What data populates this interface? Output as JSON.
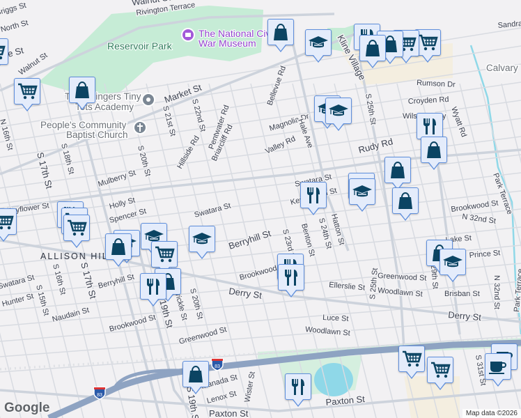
{
  "map": {
    "attribution": "Map data ©2026",
    "logo": "Google",
    "neighborhood": "ALLISON HILL",
    "park": "Reservoir Park",
    "places": {
      "museum": [
        "The National Civil",
        "War Museum"
      ],
      "academy": [
        "The Stringers Tiny",
        "Tots Academy"
      ],
      "church": [
        "People's Community",
        "Baptist Church"
      ],
      "cemetery": "Calvary"
    },
    "highway_shield": "83",
    "streets": {
      "walnut_top": "Walnut St",
      "rivington": "Rivington Terrace",
      "briggs": "Briggs St",
      "north": "North St",
      "state": "State St",
      "walnut": "Walnut St",
      "market": "Market St",
      "s21": "S 21st St",
      "s22": "S 22nd St",
      "hillside": "Hillside Rd",
      "pentwater": "Pentwater Rd",
      "briarcliff": "Briarcliff Rd",
      "s17": "S 17th St",
      "s18": "S 18th St",
      "n16": "N 16th St",
      "s20": "S 20th St",
      "mulberry": "Mulberry St",
      "holly": "Holly St",
      "spencer": "Spencer St",
      "swatara": "Swatara St",
      "mayflower": "Mayflower St",
      "bellevue": "Bellevue Rd",
      "magnolia": "Magnolia Dr",
      "valley": "Valley Rd",
      "kline": "Kline Village",
      "s25": "S 25th St",
      "rumson": "Rumson Dr",
      "croyden": "Croyden Rd",
      "wilson": "Wilson Pkwy",
      "wyatt": "Wyatt Rd",
      "rudy": "Rudy Rd",
      "swatara2": "Swatara St",
      "kensington": "Kensington St",
      "sandra": "Sandra",
      "park_terrace": "Park Terrace",
      "brookwood_e": "Brookwood St",
      "n32": "N 32nd St",
      "hale": "Hale Ave",
      "berryhill": "Berryhill St",
      "s23": "S 23rd St",
      "benton": "Benton St",
      "s24": "S 24th St",
      "hatton": "Hatton St",
      "swatara3": "Swatara St",
      "s16": "S 16th St",
      "s17b": "S 17th St",
      "hunter": "Hunter St",
      "s15": "S 15th St",
      "berryhill2": "Berryhill St",
      "naudain": "Naudain St",
      "brookwood": "Brookwood St",
      "s20b": "S 20th St",
      "greenwood": "Greenwood St",
      "derry": "Derry St",
      "brookwood2": "Brookwood St",
      "s19": "S 19th St",
      "crickle": "Crickle St",
      "greenwood2": "Greenwood St",
      "ellerslie": "Ellerslie St",
      "woodlawn": "Woodlawn St",
      "s25b": "S 25th St",
      "brisban": "Brisban St",
      "n32b": "N 32nd St",
      "park_terrace2": "Park Terrace",
      "derry2": "Derry St",
      "luce": "Luce St",
      "woodlawn2": "Woodlawn St",
      "s31": "S 31st St",
      "prince": "Prince St",
      "lake": "Lake St",
      "s29": "S 29th St",
      "paxton": "Paxton St",
      "paxton2": "Paxton St",
      "s19b": "S 19th St",
      "wister": "Wister St",
      "manada": "Manada St",
      "lenox": "Lenox St"
    },
    "colors": {
      "park": "#c6ecd6",
      "water": "#8fd8e8",
      "highway": "#8ea3c2",
      "marker_icon": "#0b4463",
      "marker_bg": "#e4ecfb",
      "marker_border": "#5f8fdc"
    }
  }
}
